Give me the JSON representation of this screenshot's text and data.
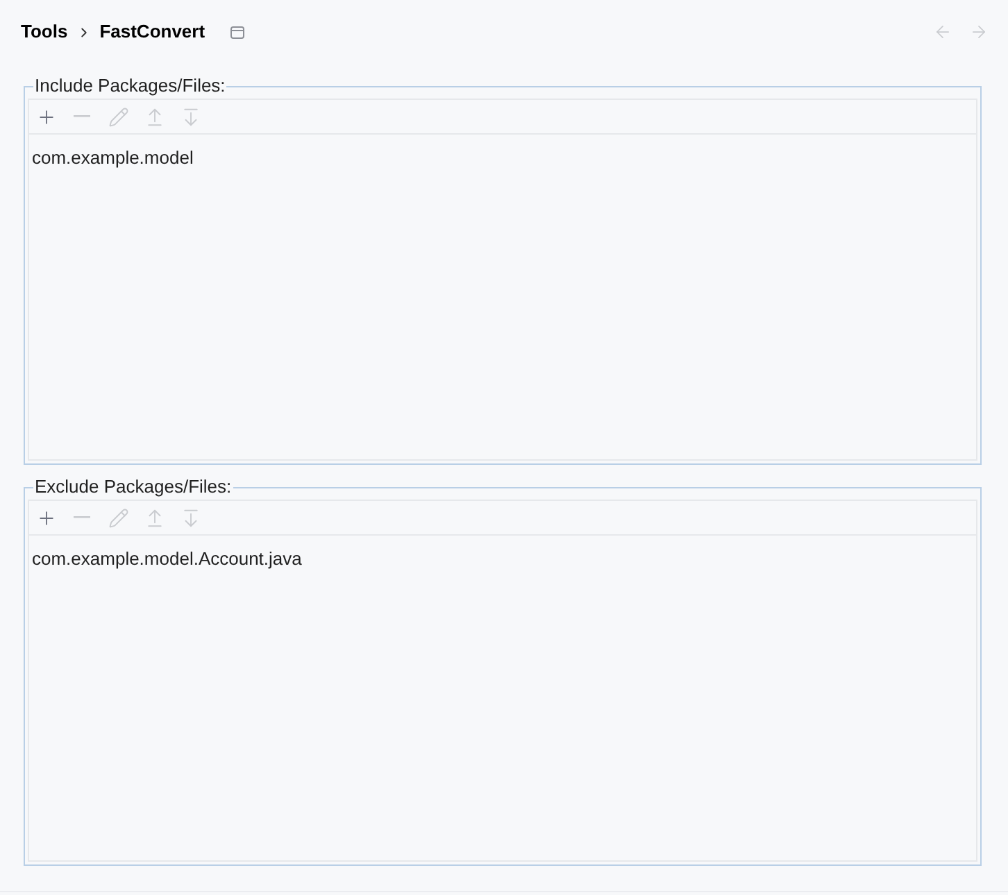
{
  "breadcrumb": [
    {
      "label": "Tools"
    },
    {
      "label": "FastConvert"
    }
  ],
  "nav": [
    {
      "kind": "back",
      "disabled": true
    },
    {
      "kind": "forward",
      "disabled": true
    }
  ],
  "groups": [
    {
      "legend": "Include Packages/Files:",
      "toolbar": [
        {
          "kind": "add",
          "disabled": false
        },
        {
          "kind": "remove",
          "disabled": true
        },
        {
          "kind": "edit",
          "disabled": true
        },
        {
          "kind": "move_up",
          "disabled": true
        },
        {
          "kind": "move_down",
          "disabled": true
        }
      ],
      "items": [
        {
          "text": "com.example.model",
          "selected": false
        }
      ]
    },
    {
      "legend": "Exclude Packages/Files:",
      "toolbar": [
        {
          "kind": "add",
          "disabled": false
        },
        {
          "kind": "remove",
          "disabled": true
        },
        {
          "kind": "edit",
          "disabled": true
        },
        {
          "kind": "move_up",
          "disabled": true
        },
        {
          "kind": "move_down",
          "disabled": true
        }
      ],
      "items": [
        {
          "text": "com.example.model.Account.java",
          "selected": false
        }
      ]
    }
  ]
}
